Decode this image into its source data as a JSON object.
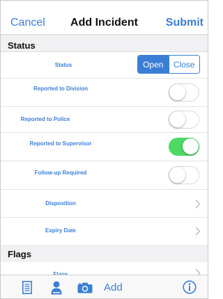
{
  "nav": {
    "cancel": "Cancel",
    "title": "Add Incident",
    "submit": "Submit"
  },
  "sections": {
    "status": "Status",
    "flags": "Flags"
  },
  "status_row": {
    "label": "Status",
    "options": [
      "Open",
      "Close"
    ],
    "selected": "Open"
  },
  "toggles": [
    {
      "label": "Reported to Division",
      "on": false
    },
    {
      "label": "Reported to Police",
      "on": false
    },
    {
      "label": "Reported to Supervisor",
      "on": true
    },
    {
      "label": "Follow-up Required",
      "on": false
    }
  ],
  "disclosures": {
    "disposition": "Disposition",
    "expiry": "Expiry Date",
    "flags": "Flags"
  },
  "tabbar": {
    "add_label": "Add",
    "icons": [
      "document-icon",
      "person-icon",
      "camera-icon",
      "info-icon"
    ]
  },
  "colors": {
    "accent": "#3a7fd5",
    "toggle_on": "#4cd964",
    "section_bg": "#f1f1f3"
  }
}
